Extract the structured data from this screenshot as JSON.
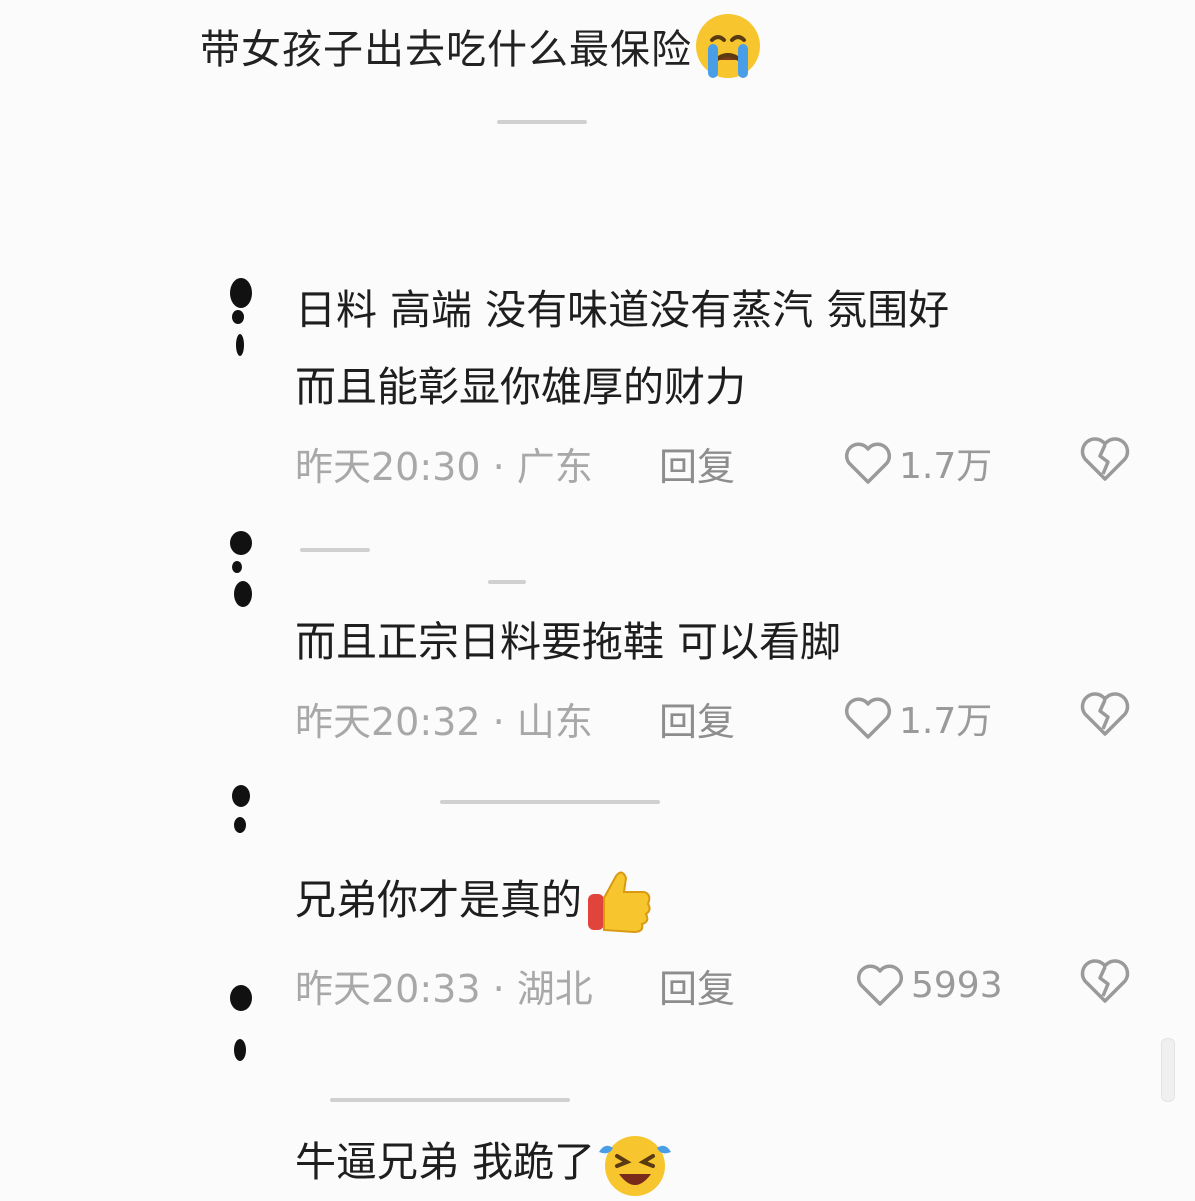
{
  "post": {
    "title": "带女孩子出去吃什么最保险",
    "title_emoji": "crying-face-emoji"
  },
  "comments": [
    {
      "lines": [
        "日料  高端  没有味道没有蒸汽  氛围好",
        "而且能彰显你雄厚的财力"
      ],
      "time": "昨天20:30 · 广东",
      "reply_label": "回复",
      "likes": "1.7万"
    },
    {
      "lines": [
        "而且正宗日料要拖鞋  可以看脚"
      ],
      "time": "昨天20:32 · 山东",
      "reply_label": "回复",
      "likes": "1.7万"
    },
    {
      "lines": [
        "兄弟你才是真的"
      ],
      "emoji": "thumbs-up-emoji",
      "time": "昨天20:33 · 湖北",
      "reply_label": "回复",
      "likes": "5993"
    },
    {
      "lines": [
        "牛逼兄弟  我跪了"
      ],
      "emoji": "laughing-crying-emoji"
    }
  ],
  "icons": {
    "like": "heart-outline-icon",
    "dislike": "broken-heart-icon"
  },
  "colors": {
    "background": "#fbfbfb",
    "text": "#1e1e1e",
    "meta": "#a8a8a8",
    "emoji_yellow": "#f7c62f",
    "emoji_blue": "#4a9ee8"
  }
}
